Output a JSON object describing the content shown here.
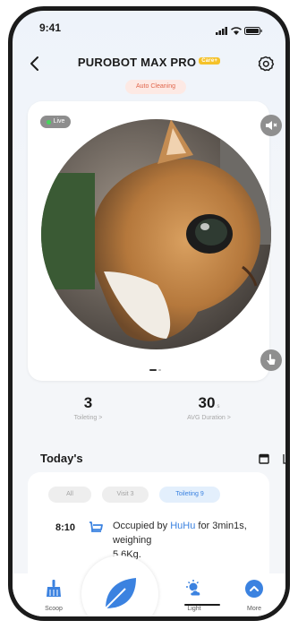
{
  "status_bar": {
    "time": "9:41"
  },
  "header": {
    "title": "PUROBOT MAX PRO",
    "badge": "Care+",
    "state": "Auto Cleaning"
  },
  "camera": {
    "live_label": "Live",
    "pager_active_index": 0,
    "pager_count": 2
  },
  "stats": [
    {
      "value": "3",
      "unit": "",
      "label": "Toileting >"
    },
    {
      "value": "30",
      "unit": "s",
      "label": "AVG Duration >"
    }
  ],
  "today": {
    "title": "Today's",
    "filters": [
      {
        "label": "All",
        "active": false
      },
      {
        "label": "Visit 3",
        "active": false
      },
      {
        "label": "Toileting 9",
        "active": true
      }
    ],
    "events": [
      {
        "time": "8:10",
        "prefix": "Occupied by ",
        "who": "HuHu",
        "suffix": " for 3min1s, weighing",
        "line3": "5.6Kg."
      }
    ]
  },
  "bottom_nav": [
    {
      "label": "Scoop",
      "icon": "broom-icon"
    },
    {
      "label": "",
      "icon": "leaf-icon"
    },
    {
      "label": "Light",
      "icon": "sun-cloud-icon"
    },
    {
      "label": "More",
      "icon": "chevron-up-circle-icon"
    }
  ],
  "colors": {
    "accent": "#3b82e0",
    "status_pill_bg": "#fde9e4",
    "status_pill_text": "#e0664c",
    "live_dot": "#43d65a",
    "badge": "#f5c22a"
  }
}
